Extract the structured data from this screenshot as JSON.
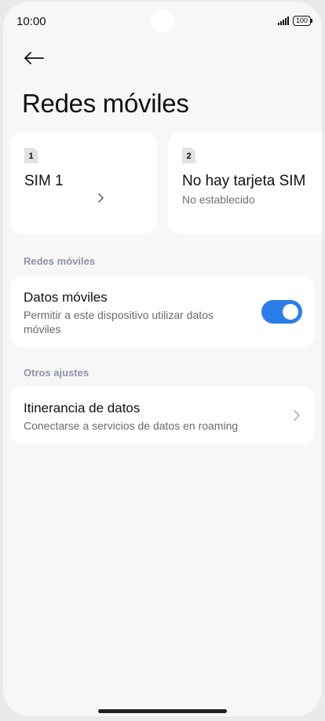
{
  "status_bar": {
    "time": "10:00",
    "battery": "100",
    "signal_icon": "signal-bars-icon",
    "battery_icon": "battery-icon"
  },
  "header": {
    "back_icon": "arrow-left-icon",
    "title": "Redes móviles"
  },
  "sim_cards": [
    {
      "slot": "1",
      "name": "SIM 1",
      "subtitle": ""
    },
    {
      "slot": "2",
      "name": "No hay tarjeta SIM",
      "subtitle": "No establecido"
    }
  ],
  "sections": {
    "mobile_networks": {
      "label": "Redes móviles",
      "mobile_data": {
        "title": "Datos móviles",
        "description": "Permitir a este dispositivo utilizar datos móviles",
        "enabled": true
      }
    },
    "other_settings": {
      "label": "Otros ajustes",
      "roaming": {
        "title": "Itinerancia de datos",
        "description": "Conectarse a servicios de datos en roaming"
      }
    }
  },
  "colors": {
    "accent": "#2b7de9",
    "section_label": "#8d92a8",
    "background": "#f7f7f7",
    "card": "#ffffff"
  }
}
